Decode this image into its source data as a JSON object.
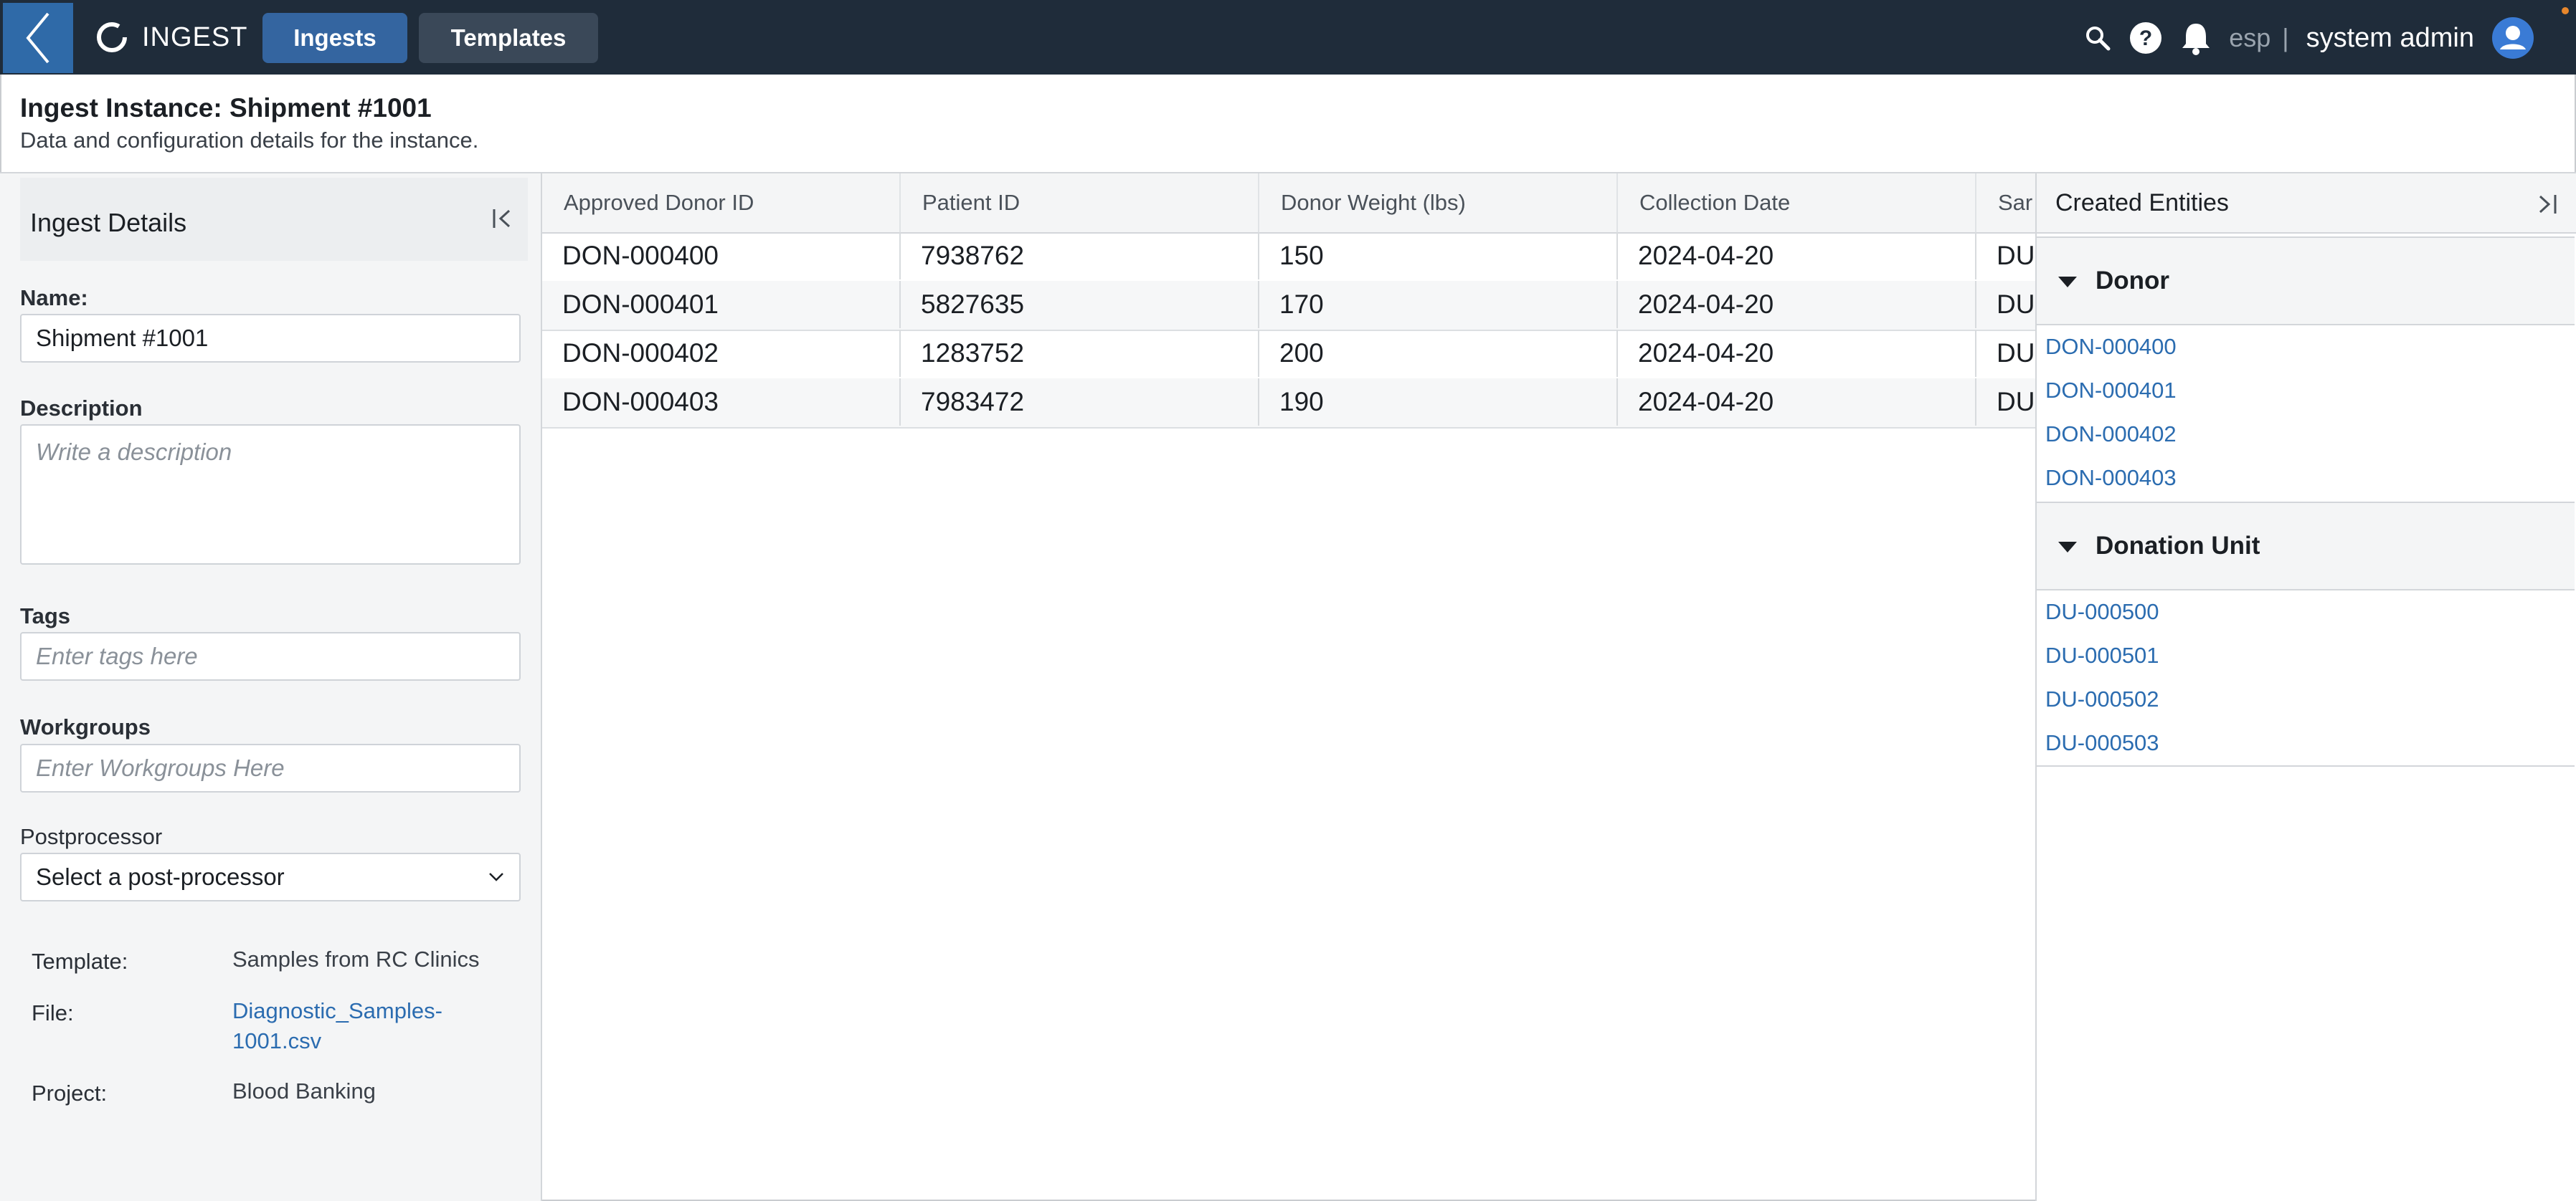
{
  "nav": {
    "logo_text": "INGEST",
    "tabs": [
      "Ingests",
      "Templates"
    ],
    "lang": "esp",
    "separator": "|",
    "user": "system admin"
  },
  "page": {
    "title": "Ingest Instance: Shipment #1001",
    "subtitle": "Data and configuration details for the instance."
  },
  "details": {
    "header": "Ingest Details",
    "name_label": "Name:",
    "name_value": "Shipment #1001",
    "description_label": "Description",
    "description_placeholder": "Write a description",
    "tags_label": "Tags",
    "tags_placeholder": "Enter tags here",
    "workgroups_label": "Workgroups",
    "workgroups_placeholder": "Enter Workgroups Here",
    "postprocessor_label": "Postprocessor",
    "postprocessor_value": "Select a post-processor",
    "template_label": "Template:",
    "template_value": "Samples from RC Clinics",
    "file_label": "File:",
    "file_value": "Diagnostic_Samples-1001.csv",
    "project_label": "Project:",
    "project_value": "Blood Banking"
  },
  "table": {
    "columns": [
      "Approved Donor ID",
      "Patient ID",
      "Donor Weight (lbs)",
      "Collection Date",
      "Sar"
    ],
    "rows": [
      [
        "DON-000400",
        "7938762",
        "150",
        "2024-04-20",
        "DU"
      ],
      [
        "DON-000401",
        "5827635",
        "170",
        "2024-04-20",
        "DU"
      ],
      [
        "DON-000402",
        "1283752",
        "200",
        "2024-04-20",
        "DU"
      ],
      [
        "DON-000403",
        "7983472",
        "190",
        "2024-04-20",
        "DU"
      ]
    ]
  },
  "entities": {
    "header": "Created Entities",
    "groups": [
      {
        "title": "Donor",
        "items": [
          "DON-000400",
          "DON-000401",
          "DON-000402",
          "DON-000403"
        ]
      },
      {
        "title": "Donation Unit",
        "items": [
          "DU-000500",
          "DU-000501",
          "DU-000502",
          "DU-000503"
        ]
      }
    ]
  },
  "colors": {
    "nav_bg": "#1f2c3a",
    "accent": "#2f6aa8",
    "link": "#2b6cb0",
    "notification_dot": "#e8872c"
  },
  "icons": [
    "back-chevron-icon",
    "logo-ring-icon",
    "search-icon",
    "help-icon",
    "bell-icon",
    "user-avatar-icon",
    "collapse-left-icon",
    "collapse-right-icon",
    "caret-down-icon",
    "chevron-down-icon"
  ]
}
